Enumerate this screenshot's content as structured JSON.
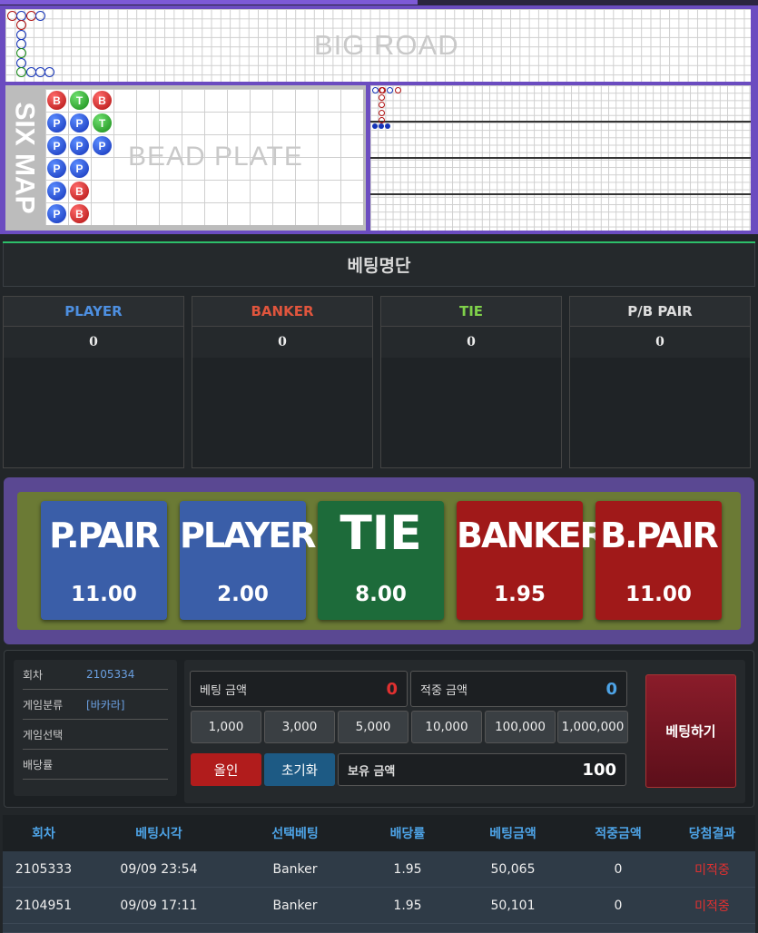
{
  "roads": {
    "big_road_title": "BIG ROAD",
    "bead_plate_title": "BEAD PLATE",
    "six_map_title": "SIX MAP",
    "bead_plate": [
      [
        "B",
        "P",
        "P",
        "P",
        "P",
        "P"
      ],
      [
        "T",
        "P",
        "P",
        "P",
        "B",
        "B"
      ],
      [
        "B",
        "T",
        "P"
      ]
    ],
    "colors": {
      "player": "#1433b8",
      "banker": "#b01010",
      "tie": "#178a17"
    }
  },
  "bet_list": {
    "title": "베팅명단",
    "categories": [
      {
        "label": "PLAYER",
        "value": "0",
        "color": "#4d8fe0"
      },
      {
        "label": "BANKER",
        "value": "0",
        "color": "#e0553d"
      },
      {
        "label": "TIE",
        "value": "0",
        "color": "#7fd14a"
      },
      {
        "label": "P/B PAIR",
        "value": "0",
        "color": "#dddddd"
      }
    ]
  },
  "bet_buttons": [
    {
      "name": "P.PAIR",
      "odds": "11.00",
      "color": "#3a5ea8"
    },
    {
      "name": "PLAYER",
      "odds": "2.00",
      "color": "#3a5ea8"
    },
    {
      "name": "TIE",
      "odds": "8.00",
      "color": "#1d6b3a"
    },
    {
      "name": "BANKER",
      "odds": "1.95",
      "color": "#a01919"
    },
    {
      "name": "B.PAIR",
      "odds": "11.00",
      "color": "#a01919"
    }
  ],
  "info": {
    "round_label": "회차",
    "round_value": "2105334",
    "game_type_label": "게임분류",
    "game_type_value": "[바카라]",
    "game_select_label": "게임선택",
    "odds_label": "배당률"
  },
  "betting": {
    "bet_amount_label": "베팅 금액",
    "bet_amount_value": "0",
    "win_amount_label": "적중 금액",
    "win_amount_value": "0",
    "chips": [
      "1,000",
      "3,000",
      "5,000",
      "10,000",
      "100,000",
      "1,000,000"
    ],
    "all_in_label": "올인",
    "reset_label": "초기화",
    "balance_label": "보유 금액",
    "balance_value": "100",
    "place_bet_label": "베팅하기"
  },
  "history": {
    "headers": [
      "회차",
      "베팅시각",
      "선택베팅",
      "배당률",
      "베팅금액",
      "적중금액",
      "당첨결과"
    ],
    "rows": [
      [
        "2105333",
        "09/09 23:54",
        "Banker",
        "1.95",
        "50,065",
        "0",
        "미적중"
      ],
      [
        "2104951",
        "09/09 17:11",
        "Banker",
        "1.95",
        "50,101",
        "0",
        "미적중"
      ]
    ]
  }
}
